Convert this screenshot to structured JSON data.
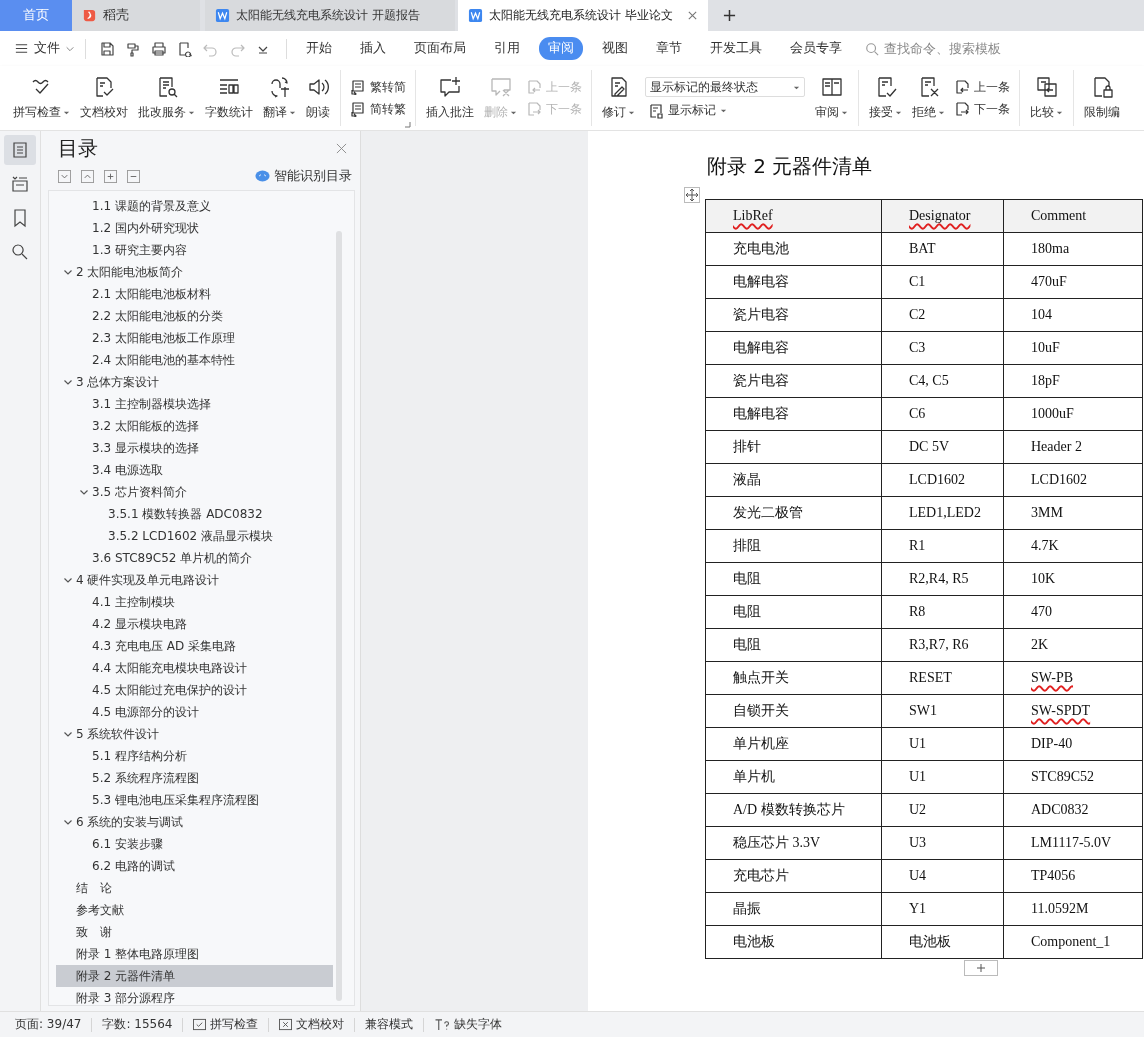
{
  "tabs": [
    {
      "kind": "home",
      "label": "首页",
      "selected": false
    },
    {
      "kind": "store",
      "label": "稻壳",
      "selected": false
    },
    {
      "kind": "doc",
      "label": "太阳能无线充电系统设计 开题报告",
      "selected": false
    },
    {
      "kind": "doc",
      "label": "太阳能无线充电系统设计 毕业论文",
      "selected": true
    }
  ],
  "menu": {
    "file_label": "文件",
    "quick_tools": [
      {
        "kind": "save",
        "disabled": false
      },
      {
        "kind": "painter",
        "disabled": false
      },
      {
        "kind": "print",
        "disabled": false
      },
      {
        "kind": "preview",
        "disabled": false
      },
      {
        "kind": "undo",
        "disabled": true
      },
      {
        "kind": "redo",
        "disabled": true
      },
      {
        "kind": "more",
        "disabled": false
      }
    ],
    "ribbon_tabs": [
      {
        "label": "开始",
        "selected": false
      },
      {
        "label": "插入",
        "selected": false
      },
      {
        "label": "页面布局",
        "selected": false
      },
      {
        "label": "引用",
        "selected": false
      },
      {
        "label": "审阅",
        "selected": true
      },
      {
        "label": "视图",
        "selected": false
      },
      {
        "label": "章节",
        "selected": false
      },
      {
        "label": "开发工具",
        "selected": false
      },
      {
        "label": "会员专享",
        "selected": false
      }
    ],
    "search": {
      "placeholder": "查找命令、搜索模板"
    }
  },
  "ribbon": [
    {
      "launcher": false,
      "controls": [
        {
          "kind": "large",
          "label": "拼写检查",
          "dropdown": true,
          "disabled": false
        },
        {
          "kind": "large",
          "label": "文档校对",
          "dropdown": false,
          "disabled": false
        },
        {
          "kind": "large",
          "label": "批改服务",
          "dropdown": true,
          "disabled": false
        },
        {
          "kind": "large",
          "label": "字数统计",
          "dropdown": false,
          "disabled": false
        },
        {
          "kind": "large",
          "label": "翻译",
          "dropdown": true,
          "disabled": false
        },
        {
          "kind": "large",
          "label": "朗读",
          "dropdown": false,
          "disabled": false
        }
      ]
    },
    {
      "launcher": true,
      "controls": [
        {
          "kind": "stack",
          "items": [
            {
              "label": "繁转简",
              "disabled": false
            },
            {
              "label": "简转繁",
              "disabled": false
            }
          ]
        }
      ]
    },
    {
      "launcher": false,
      "controls": [
        {
          "kind": "large",
          "label": "插入批注",
          "dropdown": false,
          "disabled": false
        },
        {
          "kind": "large",
          "label": "删除",
          "dropdown": true,
          "disabled": true
        },
        {
          "kind": "stack",
          "items": [
            {
              "label": "上一条",
              "disabled": true
            },
            {
              "label": "下一条",
              "disabled": true
            }
          ]
        }
      ]
    },
    {
      "launcher": false,
      "controls": [
        {
          "kind": "large",
          "label": "修订",
          "dropdown": true,
          "disabled": false
        },
        {
          "kind": "select",
          "value": "显示标记的最终状态",
          "below": {
            "label": "显示标记",
            "dropdown": true,
            "disabled": false
          }
        },
        {
          "kind": "large",
          "label": "审阅",
          "dropdown": true,
          "disabled": false
        }
      ]
    },
    {
      "launcher": false,
      "controls": [
        {
          "kind": "large",
          "label": "接受",
          "dropdown": true,
          "disabled": false
        },
        {
          "kind": "large",
          "label": "拒绝",
          "dropdown": true,
          "disabled": false
        },
        {
          "kind": "stack",
          "items": [
            {
              "label": "上一条",
              "disabled": false
            },
            {
              "label": "下一条",
              "disabled": false
            }
          ]
        }
      ]
    },
    {
      "launcher": false,
      "controls": [
        {
          "kind": "large",
          "label": "比较",
          "dropdown": true,
          "disabled": false
        }
      ]
    },
    {
      "launcher": false,
      "controls": [
        {
          "kind": "large",
          "label": "限制编",
          "dropdown": false,
          "disabled": false
        }
      ]
    }
  ],
  "side_rail": [
    {
      "kind": "toc",
      "selected": true
    },
    {
      "kind": "nav",
      "selected": false
    },
    {
      "kind": "bookmark",
      "selected": false
    },
    {
      "kind": "search",
      "selected": false
    }
  ],
  "toc_panel": {
    "title": "目录",
    "smart_label": "智能识别目录",
    "items": [
      {
        "kind": "continued",
        "children": [
          {
            "label": "1.1 课题的背景及意义",
            "selected": false
          },
          {
            "label": "1.2 国内外研究现状",
            "selected": false
          },
          {
            "label": "1.3 研究主要内容",
            "selected": false
          }
        ]
      },
      {
        "label": "2  太阳能电池板简介",
        "selected": false,
        "expanded": true,
        "children": [
          {
            "label": "2.1 太阳能电池板材料",
            "selected": false
          },
          {
            "label": "2.2 太阳能电池板的分类",
            "selected": false
          },
          {
            "label": "2.3 太阳能电池板工作原理",
            "selected": false
          },
          {
            "label": "2.4 太阳能电池的基本特性",
            "selected": false
          }
        ]
      },
      {
        "label": "3  总体方案设计",
        "selected": false,
        "expanded": true,
        "children": [
          {
            "label": "3.1 主控制器模块选择",
            "selected": false
          },
          {
            "label": "3.2 太阳能板的选择",
            "selected": false
          },
          {
            "label": "3.3 显示模块的选择",
            "selected": false
          },
          {
            "label": "3.4 电源选取",
            "selected": false
          },
          {
            "label": "3.5 芯片资料简介",
            "selected": false,
            "expanded": true,
            "children": [
              {
                "label": "3.5.1 模数转换器 ADC0832",
                "selected": false
              },
              {
                "label": "3.5.2 LCD1602 液晶显示模块",
                "selected": false
              }
            ]
          },
          {
            "label": "3.6 STC89C52 单片机的简介",
            "selected": false
          }
        ]
      },
      {
        "label": "4  硬件实现及单元电路设计",
        "selected": false,
        "expanded": true,
        "children": [
          {
            "label": "4.1 主控制模块",
            "selected": false
          },
          {
            "label": "4.2 显示模块电路",
            "selected": false
          },
          {
            "label": "4.3 充电电压 AD 采集电路",
            "selected": false
          },
          {
            "label": "4.4 太阳能充电模块电路设计",
            "selected": false
          },
          {
            "label": "4.5 太阳能过充电保护的设计",
            "selected": false
          },
          {
            "label": "4.5 电源部分的设计",
            "selected": false
          }
        ]
      },
      {
        "label": "5  系统软件设计",
        "selected": false,
        "expanded": true,
        "children": [
          {
            "label": "5.1 程序结构分析",
            "selected": false
          },
          {
            "label": "5.2 系统程序流程图",
            "selected": false
          },
          {
            "label": "5.3 锂电池电压采集程序流程图",
            "selected": false
          }
        ]
      },
      {
        "label": "6  系统的安装与调试",
        "selected": false,
        "expanded": true,
        "children": [
          {
            "label": "6.1 安装步骤",
            "selected": false
          },
          {
            "label": "6.2 电路的调试",
            "selected": false
          }
        ]
      },
      {
        "label": "结　论",
        "selected": false
      },
      {
        "label": "参考文献",
        "selected": false
      },
      {
        "label": "致　谢",
        "selected": false
      },
      {
        "label": "附录 1 整体电路原理图",
        "selected": false
      },
      {
        "label": "附录 2 元器件清单",
        "selected": true
      },
      {
        "label": "附录 3 部分源程序",
        "selected": false
      }
    ]
  },
  "document": {
    "heading": "附录 2 元器件清单",
    "table": {
      "columns": [
        {
          "text": "LibRef",
          "misspelled": true
        },
        {
          "text": "Designator",
          "misspelled": true
        },
        {
          "text": "Comment",
          "misspelled": false
        }
      ],
      "rows": [
        [
          {
            "text": "充电电池",
            "misspelled": false
          },
          {
            "text": "BAT",
            "misspelled": false
          },
          {
            "text": "180ma",
            "misspelled": false
          }
        ],
        [
          {
            "text": "电解电容",
            "misspelled": false
          },
          {
            "text": "C1",
            "misspelled": false
          },
          {
            "text": "470uF",
            "misspelled": false
          }
        ],
        [
          {
            "text": "瓷片电容",
            "misspelled": false
          },
          {
            "text": "C2",
            "misspelled": false
          },
          {
            "text": "104",
            "misspelled": false
          }
        ],
        [
          {
            "text": "电解电容",
            "misspelled": false
          },
          {
            "text": "C3",
            "misspelled": false
          },
          {
            "text": "10uF",
            "misspelled": false
          }
        ],
        [
          {
            "text": "瓷片电容",
            "misspelled": false
          },
          {
            "text": "C4, C5",
            "misspelled": false
          },
          {
            "text": "18pF",
            "misspelled": false
          }
        ],
        [
          {
            "text": "电解电容",
            "misspelled": false
          },
          {
            "text": "C6",
            "misspelled": false
          },
          {
            "text": "1000uF",
            "misspelled": false
          }
        ],
        [
          {
            "text": "排针",
            "misspelled": false
          },
          {
            "text": "DC 5V",
            "misspelled": false
          },
          {
            "text": "Header 2",
            "misspelled": false
          }
        ],
        [
          {
            "text": "液晶",
            "misspelled": false
          },
          {
            "text": "LCD1602",
            "misspelled": false
          },
          {
            "text": "LCD1602",
            "misspelled": false
          }
        ],
        [
          {
            "text": "发光二极管",
            "misspelled": false
          },
          {
            "text": "LED1,LED2",
            "misspelled": false
          },
          {
            "text": "3MM",
            "misspelled": false
          }
        ],
        [
          {
            "text": "排阻",
            "misspelled": false
          },
          {
            "text": "R1",
            "misspelled": false
          },
          {
            "text": "4.7K",
            "misspelled": false
          }
        ],
        [
          {
            "text": "电阻",
            "misspelled": false
          },
          {
            "text": "R2,R4, R5",
            "misspelled": false
          },
          {
            "text": "10K",
            "misspelled": false
          }
        ],
        [
          {
            "text": "电阻",
            "misspelled": false
          },
          {
            "text": "R8",
            "misspelled": false
          },
          {
            "text": "470",
            "misspelled": false
          }
        ],
        [
          {
            "text": "电阻",
            "misspelled": false
          },
          {
            "text": "R3,R7, R6",
            "misspelled": false
          },
          {
            "text": "2K",
            "misspelled": false
          }
        ],
        [
          {
            "text": "触点开关",
            "misspelled": false
          },
          {
            "text": "RESET",
            "misspelled": false
          },
          {
            "text": "SW-PB",
            "misspelled": true
          }
        ],
        [
          {
            "text": "自锁开关",
            "misspelled": false
          },
          {
            "text": "SW1",
            "misspelled": false
          },
          {
            "text": "SW-SPDT",
            "misspelled": true
          }
        ],
        [
          {
            "text": "单片机座",
            "misspelled": false
          },
          {
            "text": "U1",
            "misspelled": false
          },
          {
            "text": "DIP-40",
            "misspelled": false
          }
        ],
        [
          {
            "text": "单片机",
            "misspelled": false
          },
          {
            "text": "U1",
            "misspelled": false
          },
          {
            "text": "STC89C52",
            "misspelled": false
          }
        ],
        [
          {
            "text": "A/D 模数转换芯片",
            "misspelled": false
          },
          {
            "text": "U2",
            "misspelled": false
          },
          {
            "text": "ADC0832",
            "misspelled": false
          }
        ],
        [
          {
            "text": "稳压芯片 3.3V",
            "misspelled": false
          },
          {
            "text": "U3",
            "misspelled": false
          },
          {
            "text": "LM1117-5.0V",
            "misspelled": false
          }
        ],
        [
          {
            "text": "充电芯片",
            "misspelled": false
          },
          {
            "text": "U4",
            "misspelled": false
          },
          {
            "text": "TP4056",
            "misspelled": false
          }
        ],
        [
          {
            "text": "晶振",
            "misspelled": false
          },
          {
            "text": "Y1",
            "misspelled": false
          },
          {
            "text": "11.0592M",
            "misspelled": false
          }
        ],
        [
          {
            "text": "电池板",
            "misspelled": false
          },
          {
            "text": "电池板",
            "misspelled": false
          },
          {
            "text": "Component_1",
            "misspelled": false
          }
        ]
      ]
    }
  },
  "status_bar": [
    {
      "kind": "text",
      "label": "页面: 39/47"
    },
    {
      "kind": "text",
      "label": "字数: 15564"
    },
    {
      "kind": "spell",
      "label": "拼写检查"
    },
    {
      "kind": "proof",
      "label": "文档校对"
    },
    {
      "kind": "text",
      "label": "兼容模式"
    },
    {
      "kind": "font",
      "label": "缺失字体"
    }
  ]
}
